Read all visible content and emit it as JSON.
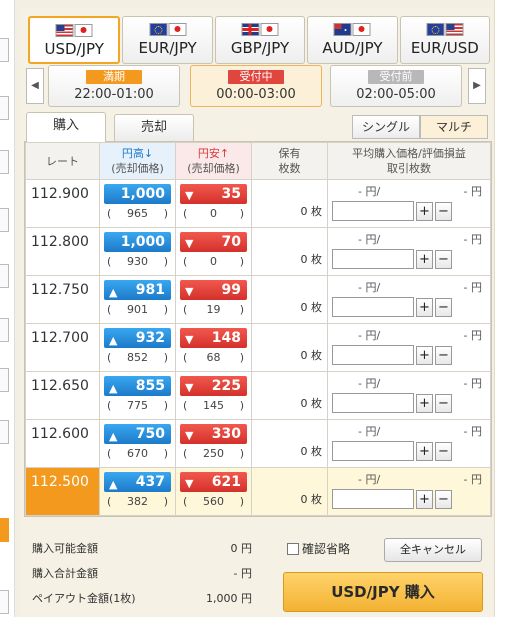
{
  "currency_tabs": [
    {
      "label": "USD/JPY",
      "flags": [
        "us",
        "jp"
      ],
      "active": true
    },
    {
      "label": "EUR/JPY",
      "flags": [
        "eu",
        "jp"
      ],
      "active": false
    },
    {
      "label": "GBP/JPY",
      "flags": [
        "gb",
        "jp"
      ],
      "active": false
    },
    {
      "label": "AUD/JPY",
      "flags": [
        "au",
        "jp"
      ],
      "active": false
    },
    {
      "label": "EUR/USD",
      "flags": [
        "eu",
        "us"
      ],
      "active": false
    }
  ],
  "sessions": [
    {
      "badge": "満期",
      "time": "22:00-01:00",
      "badge_color": "#f39a1e"
    },
    {
      "badge": "受付中",
      "time": "00:00-03:00",
      "badge_color": "#e0463e"
    },
    {
      "badge": "受付前",
      "time": "02:00-05:00",
      "badge_color": "#b8b8b8"
    }
  ],
  "session_prev_icon": "triangle-left-icon",
  "session_next_icon": "triangle-right-icon",
  "trade_tabs": {
    "buy": "購入",
    "sell": "売却"
  },
  "mode_buttons": {
    "single": "シングル",
    "multi": "マルチ"
  },
  "table": {
    "headers": {
      "rate": "レート",
      "yen_strong": "円高↓",
      "yen_strong_sub": "(売却価格)",
      "yen_weak": "円安↑",
      "yen_weak_sub": "(売却価格)",
      "holdings": "保有",
      "holdings_sub": "枚数",
      "avg": "平均購入価格/評価損益",
      "avg_sub": "取引枚数"
    },
    "rows": [
      {
        "rate": "112.900",
        "sell_price": "1,000",
        "sell_arrow": false,
        "sell_sub": "965",
        "buy_price": "35",
        "buy_sub": "0",
        "holdings": "0 枚",
        "avg_left": "- 円/",
        "avg_right": "- 円",
        "current": false
      },
      {
        "rate": "112.800",
        "sell_price": "1,000",
        "sell_arrow": false,
        "sell_sub": "930",
        "buy_price": "70",
        "buy_sub": "0",
        "holdings": "0 枚",
        "avg_left": "- 円/",
        "avg_right": "- 円",
        "current": false
      },
      {
        "rate": "112.750",
        "sell_price": "981",
        "sell_arrow": true,
        "sell_sub": "901",
        "buy_price": "99",
        "buy_sub": "19",
        "holdings": "0 枚",
        "avg_left": "- 円/",
        "avg_right": "- 円",
        "current": false
      },
      {
        "rate": "112.700",
        "sell_price": "932",
        "sell_arrow": true,
        "sell_sub": "852",
        "buy_price": "148",
        "buy_sub": "68",
        "holdings": "0 枚",
        "avg_left": "- 円/",
        "avg_right": "- 円",
        "current": false
      },
      {
        "rate": "112.650",
        "sell_price": "855",
        "sell_arrow": true,
        "sell_sub": "775",
        "buy_price": "225",
        "buy_sub": "145",
        "holdings": "0 枚",
        "avg_left": "- 円/",
        "avg_right": "- 円",
        "current": false
      },
      {
        "rate": "112.600",
        "sell_price": "750",
        "sell_arrow": true,
        "sell_sub": "670",
        "buy_price": "330",
        "buy_sub": "250",
        "holdings": "0 枚",
        "avg_left": "- 円/",
        "avg_right": "- 円",
        "current": false
      },
      {
        "rate": "112.500",
        "sell_price": "437",
        "sell_arrow": true,
        "sell_sub": "382",
        "buy_price": "621",
        "buy_sub": "560",
        "holdings": "0 枚",
        "avg_left": "- 円/",
        "avg_right": "- 円",
        "current": true
      }
    ],
    "plus": "+",
    "minus": "−"
  },
  "summary": {
    "available_label": "購入可能金額",
    "available_value": "0 円",
    "total_label": "購入合計金額",
    "total_value": "- 円",
    "payout_label": "ペイアウト金額(1枚)",
    "payout_value": "1,000 円"
  },
  "skip_confirm_label": "確認省略",
  "cancel_all_label": "全キャンセル",
  "order_button_label": "USD/JPY 購入",
  "colors": {
    "accent": "#f39a1e",
    "sell_blue": "#1c7ac9",
    "buy_red": "#d3312b"
  }
}
